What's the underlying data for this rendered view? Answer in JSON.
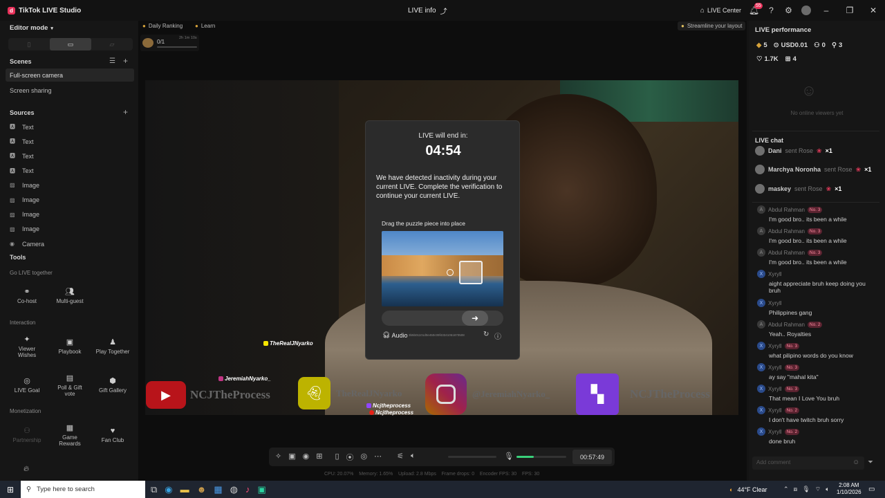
{
  "app": {
    "title": "TikTok LIVE Studio",
    "logo": "d",
    "center_title": "LIVE info",
    "live_center": "LIVE Center",
    "notif_count": "55"
  },
  "left": {
    "editor_mode": "Editor mode",
    "scenes_title": "Scenes",
    "scenes": [
      "Full-screen camera",
      "Screen sharing"
    ],
    "sources_title": "Sources",
    "sources": [
      {
        "icon": "text-icon",
        "label": "Text"
      },
      {
        "icon": "text-icon",
        "label": "Text"
      },
      {
        "icon": "text-icon",
        "label": "Text"
      },
      {
        "icon": "text-icon",
        "label": "Text"
      },
      {
        "icon": "image-icon",
        "label": "Image"
      },
      {
        "icon": "image-icon",
        "label": "Image"
      },
      {
        "icon": "image-icon",
        "label": "Image"
      },
      {
        "icon": "image-icon",
        "label": "Image"
      },
      {
        "icon": "camera-icon",
        "label": "Camera"
      }
    ],
    "tools_title": "Tools",
    "go_live_together": "Go LIVE together",
    "cohost": "Co-host",
    "multiguest": "Multi-guest",
    "interaction": "Interaction",
    "interaction_tools": [
      "Viewer Wishes",
      "Playbook",
      "Play Together",
      "LIVE Goal",
      "Poll & Gift vote",
      "Gift Gallery"
    ],
    "monetization": "Monetization",
    "monetization_tools": [
      "Partnership",
      "Game Rewards",
      "Fan Club"
    ]
  },
  "topbar": {
    "daily_ranking": "Daily Ranking",
    "learn": "Learn",
    "streamline": "Streamline your layout",
    "goal": "0/1",
    "goal_time": "2h 1m 10s"
  },
  "overlay": {
    "handle1": "TheRealJNyarko",
    "handle2": "JeremiahNyarko_",
    "handle3": "Ncjtheprocess",
    "handle4": "Ncjtheprocess",
    "yt_text": "NCJTheProcess",
    "snap_text": "TheRealJNyarko",
    "ig_text": "@JeremiahNyarko_",
    "twitch_text": "NCJTheProcess"
  },
  "modal": {
    "title": "LIVE will end in:",
    "timer": "04:54",
    "body": "We have detected inactivity during your current LIVE. Complete the verification to continue your current LIVE.",
    "puzzle_label": "Drag the puzzle piece into place",
    "audio": "Audio",
    "code": "3b5b01101d0e450c09f43341051870508"
  },
  "controls": {
    "elapsed": "00:57:49",
    "stats": "CPU: 20.07%    Memory: 1.65%    Upload: 2.8 Mbps    Frame drops: 0    Encoder FPS: 30    FPS: 30",
    "mic_level": 0.35
  },
  "right": {
    "perf_title": "LIVE performance",
    "stats": [
      {
        "icon": "diamond-icon",
        "value": "5"
      },
      {
        "icon": "coin-icon",
        "value": "USD0.01"
      },
      {
        "icon": "users-icon",
        "value": "0"
      },
      {
        "icon": "share-icon",
        "value": "3"
      },
      {
        "icon": "heart-icon",
        "value": "1.7K"
      },
      {
        "icon": "gift-icon",
        "value": "4"
      }
    ],
    "no_viewers": "No online viewers yet",
    "chat_title": "LIVE chat",
    "gifts": [
      {
        "name": "Dani",
        "text": "sent Rose",
        "count": "×1"
      },
      {
        "name": "Marchya Noronha",
        "text": "sent Rose",
        "count": "×1"
      },
      {
        "name": "maskey",
        "text": "sent Rose",
        "count": "×1"
      }
    ],
    "messages": [
      {
        "user": "Abdul Rahman",
        "level": "No. 3",
        "text": "I'm good bro.. its been a while",
        "avatar": "A"
      },
      {
        "user": "Abdul Rahman",
        "level": "No. 3",
        "text": "I'm good bro.. its been a while",
        "avatar": "A"
      },
      {
        "user": "Abdul Rahman",
        "level": "No. 3",
        "text": "I'm good bro.. its been a while",
        "avatar": "A"
      },
      {
        "user": "Xyryll",
        "level": "",
        "text": "aight appreciate bruh keep doing you bruh",
        "avatar": "X"
      },
      {
        "user": "Xyryll",
        "level": "",
        "text": "Philippines gang",
        "avatar": "X"
      },
      {
        "user": "Abdul Rahman",
        "level": "No. 2",
        "text": "Yeah.. Royalties",
        "avatar": "A"
      },
      {
        "user": "Xyryll",
        "level": "No. 3",
        "text": "what pilipino words do you know",
        "avatar": "X"
      },
      {
        "user": "Xyryll",
        "level": "No. 3",
        "text": "ay say \"mahal kita\"",
        "avatar": "X"
      },
      {
        "user": "Xyryll",
        "level": "No. 3",
        "text": "That mean I Love You bruh",
        "avatar": "X"
      },
      {
        "user": "Xyryll",
        "level": "No. 2",
        "text": "I don't have twitch bruh sorry",
        "avatar": "X"
      },
      {
        "user": "Xyryll",
        "level": "No. 2",
        "text": "done bruh",
        "avatar": "X"
      }
    ],
    "add_comment": "Add comment"
  },
  "taskbar": {
    "search": "Type here to search",
    "weather": "44°F  Clear",
    "time": "2:08 AM",
    "date": "1/10/2026"
  }
}
